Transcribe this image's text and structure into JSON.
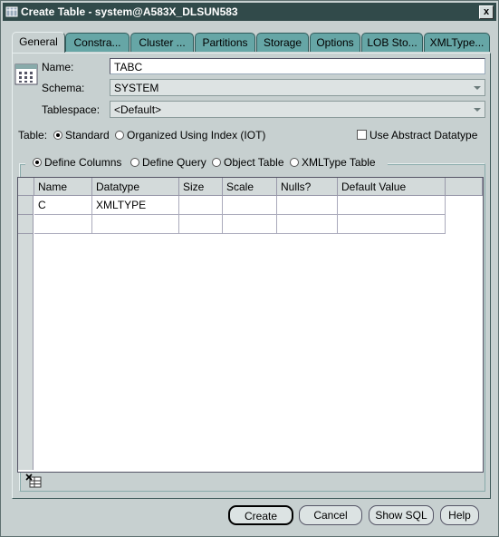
{
  "window": {
    "title": "Create Table - system@A583X_DLSUN583",
    "close_label": "x"
  },
  "tabs": [
    {
      "label": "General",
      "active": true
    },
    {
      "label": "Constra..."
    },
    {
      "label": "Cluster ..."
    },
    {
      "label": "Partitions"
    },
    {
      "label": "Storage"
    },
    {
      "label": "Options"
    },
    {
      "label": "LOB Sto..."
    },
    {
      "label": "XMLType..."
    }
  ],
  "general": {
    "name_label": "Name:",
    "name_value": "TABC",
    "schema_label": "Schema:",
    "schema_value": "SYSTEM",
    "tablespace_label": "Tablespace:",
    "tablespace_value": "<Default>"
  },
  "table_type": {
    "label": "Table:",
    "options": [
      {
        "label": "Standard",
        "selected": true
      },
      {
        "label": "Organized Using Index (IOT)",
        "selected": false
      }
    ],
    "abstract_label": "Use Abstract Datatype",
    "abstract_checked": false
  },
  "define": {
    "options": [
      {
        "label": "Define Columns",
        "selected": true
      },
      {
        "label": "Define Query",
        "selected": false
      },
      {
        "label": "Object Table",
        "selected": false
      },
      {
        "label": "XMLType Table",
        "selected": false
      }
    ]
  },
  "columns": {
    "headers": [
      "Name",
      "Datatype",
      "Size",
      "Scale",
      "Nulls?",
      "Default Value"
    ],
    "rows": [
      [
        "C",
        "XMLTYPE",
        "",
        "",
        "",
        ""
      ],
      [
        "",
        "",
        "",
        "",
        "",
        ""
      ]
    ]
  },
  "buttons": {
    "create": "Create",
    "cancel": "Cancel",
    "show_sql": "Show SQL",
    "help": "Help"
  },
  "colors": {
    "titlebar": "#314a4a",
    "tab_inactive": "#66a6a6",
    "panel": "#c7d0d0"
  }
}
